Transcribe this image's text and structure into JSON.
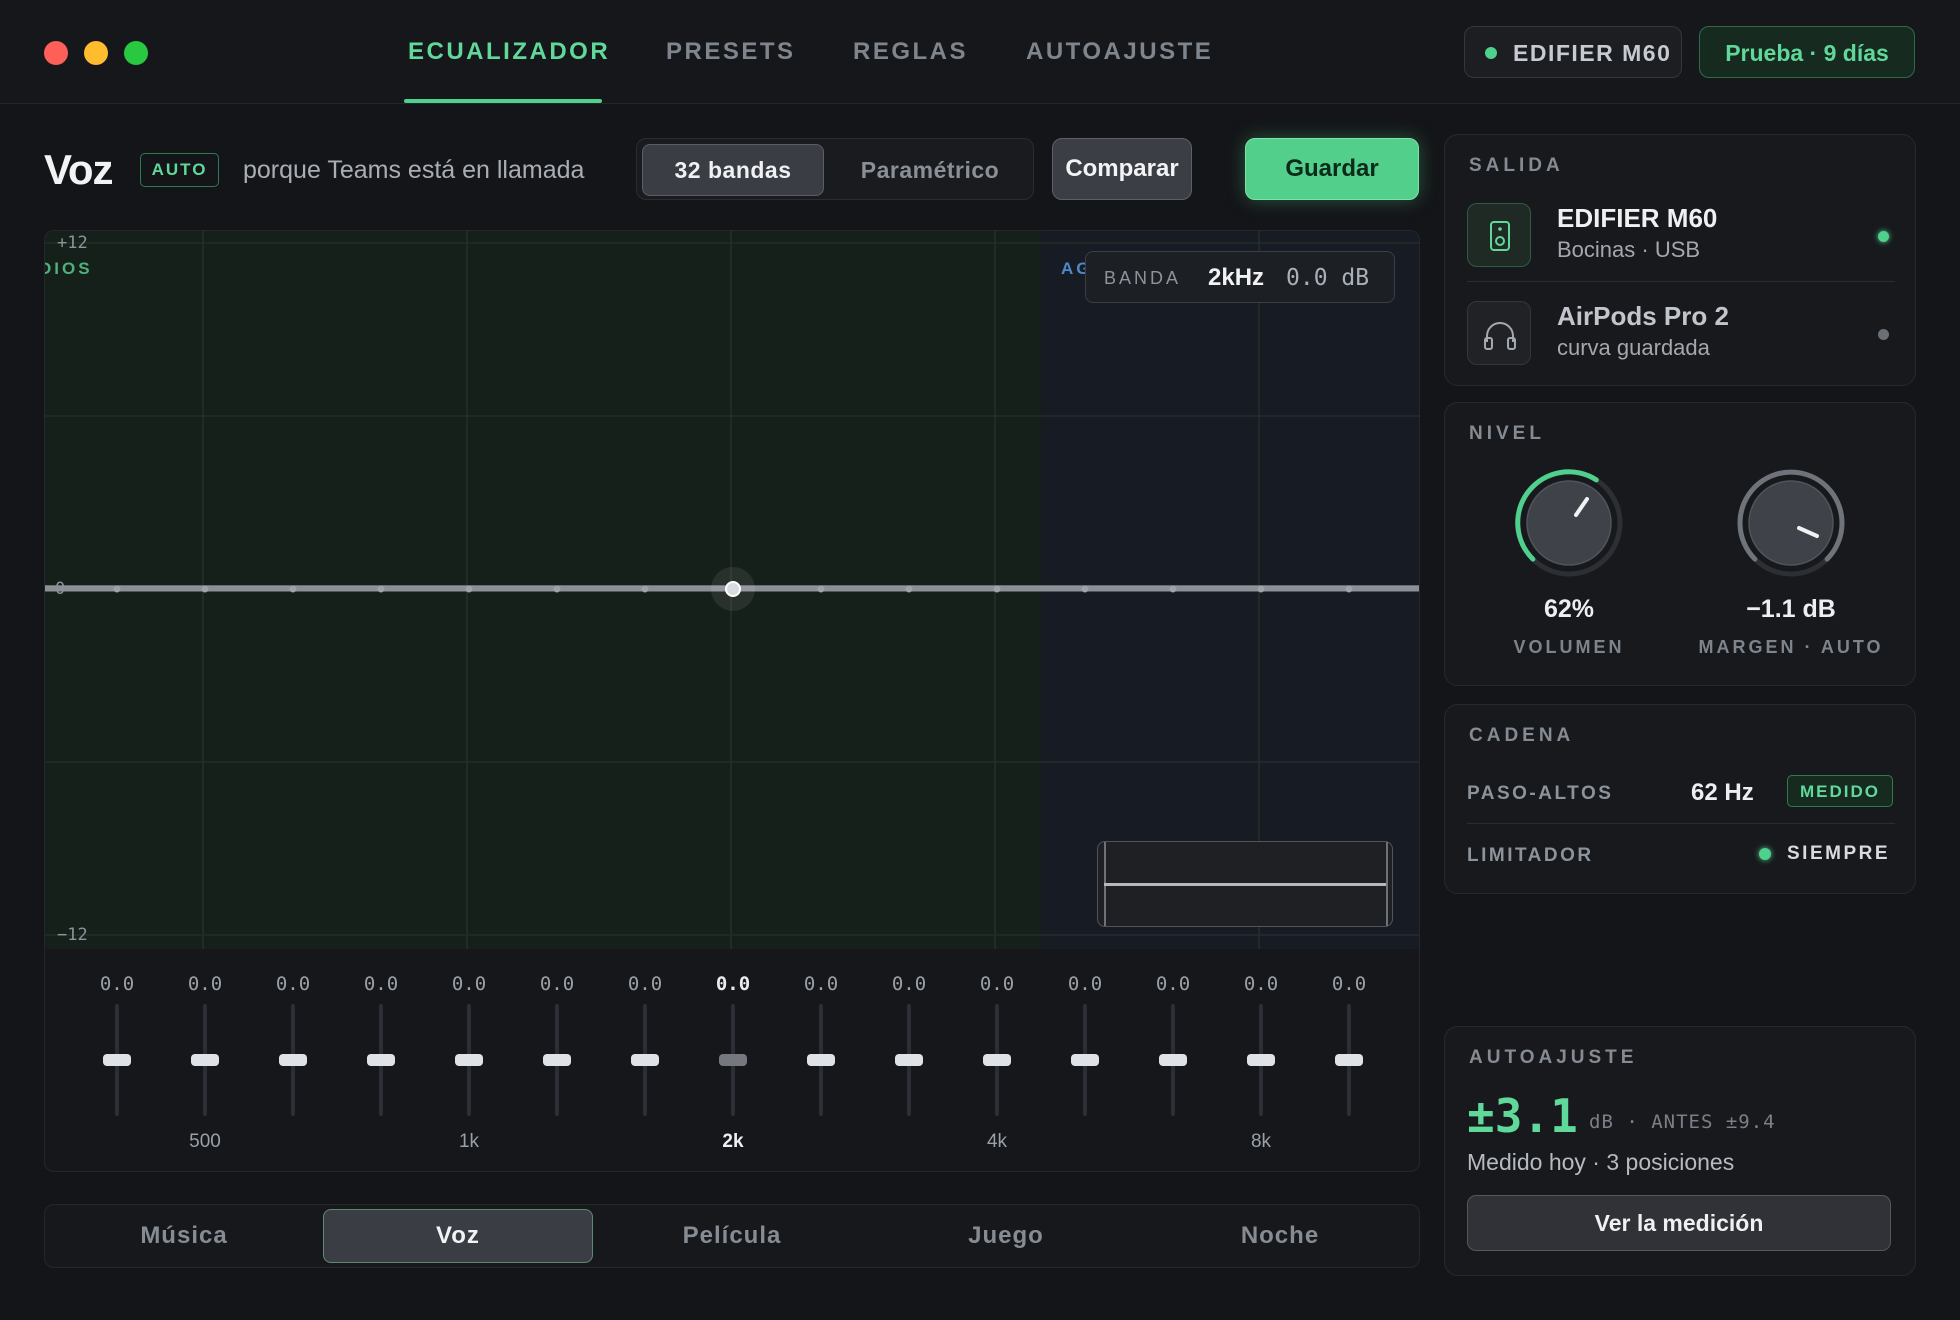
{
  "window": {
    "colors": {
      "close": "#fe5f57",
      "minimize": "#febc2e",
      "maximize": "#28c840",
      "accent": "#4fd08d"
    }
  },
  "tabs": [
    {
      "label": "ECUALIZADOR",
      "active": true
    },
    {
      "label": "PRESETS"
    },
    {
      "label": "REGLAS"
    },
    {
      "label": "AUTOAJUSTE"
    }
  ],
  "device_pill": {
    "label": "EDIFIER M60",
    "status_color": "#4fd08d"
  },
  "trial": {
    "label": "Prueba · 9 días"
  },
  "header": {
    "preset_name": "Voz",
    "auto_badge": "AUTO",
    "reason": "porque Teams está en llamada",
    "mode_options": [
      "32 bandas",
      "Paramétrico"
    ],
    "mode_selected": "32 bandas",
    "compare_label": "Comparar",
    "save_label": "Guardar"
  },
  "graph": {
    "y_max_label": "+12",
    "y_zero_label": "0",
    "y_min_label": "−12",
    "zone_left": "DIOS",
    "zone_right": "AG",
    "band_readout": {
      "key": "BANDA",
      "freq": "2kHz",
      "gain": "0.0 dB"
    }
  },
  "bands": [
    {
      "gain": "0.0",
      "freq": ""
    },
    {
      "gain": "0.0",
      "freq": "500"
    },
    {
      "gain": "0.0",
      "freq": ""
    },
    {
      "gain": "0.0",
      "freq": ""
    },
    {
      "gain": "0.0",
      "freq": "1k"
    },
    {
      "gain": "0.0",
      "freq": ""
    },
    {
      "gain": "0.0",
      "freq": ""
    },
    {
      "gain": "0.0",
      "freq": "2k",
      "selected": true
    },
    {
      "gain": "0.0",
      "freq": ""
    },
    {
      "gain": "0.0",
      "freq": ""
    },
    {
      "gain": "0.0",
      "freq": "4k"
    },
    {
      "gain": "0.0",
      "freq": ""
    },
    {
      "gain": "0.0",
      "freq": ""
    },
    {
      "gain": "0.0",
      "freq": "8k"
    },
    {
      "gain": "0.0",
      "freq": ""
    }
  ],
  "presets_bar": [
    {
      "label": "Música"
    },
    {
      "label": "Voz",
      "active": true
    },
    {
      "label": "Película"
    },
    {
      "label": "Juego"
    },
    {
      "label": "Noche"
    }
  ],
  "salida": {
    "title": "SALIDA",
    "devices": [
      {
        "name": "EDIFIER M60",
        "sub": "Bocinas · USB",
        "icon": "speaker-icon",
        "active": true,
        "dot_color": "#4fd08d"
      },
      {
        "name": "AirPods Pro 2",
        "sub": "curva guardada",
        "icon": "headphones-icon",
        "active": false,
        "dot_color": "#6b7077"
      }
    ]
  },
  "nivel": {
    "title": "NIVEL",
    "volume": {
      "value": "62%",
      "label": "VOLUMEN",
      "level": 0.62
    },
    "margin": {
      "value": "−1.1 dB",
      "label": "MARGEN · AUTO"
    }
  },
  "cadena": {
    "title": "CADENA",
    "highpass": {
      "label": "PASO-ALTOS",
      "value": "62 Hz",
      "badge": "MEDIDO"
    },
    "limiter": {
      "label": "LIMITADOR",
      "value": "SIEMPRE",
      "dot_color": "#4fd08d"
    }
  },
  "autoajuste": {
    "title": "AUTOAJUSTE",
    "value": "±3.1",
    "unit_before": "dB · ANTES ±9.4",
    "sub": "Medido hoy · 3 posiciones",
    "button": "Ver la medición"
  }
}
